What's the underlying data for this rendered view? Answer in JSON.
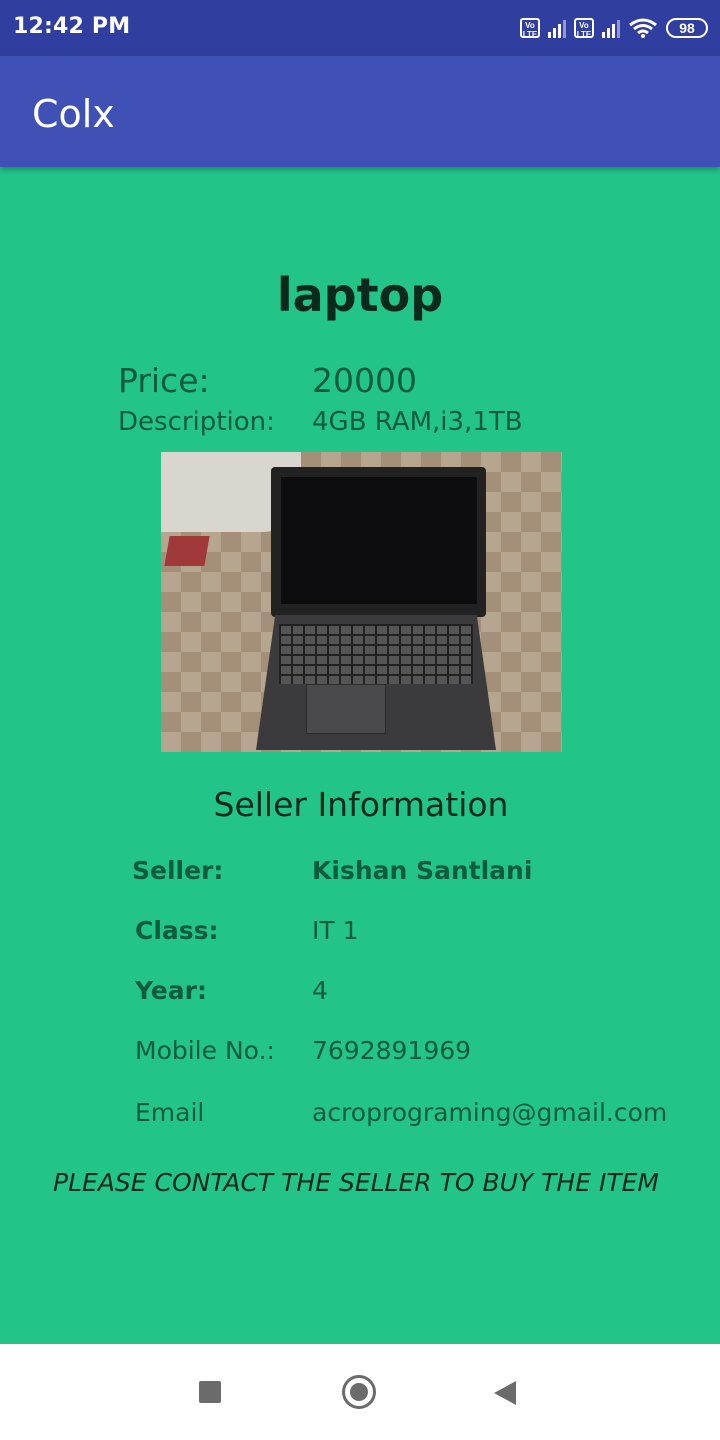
{
  "status": {
    "time": "12:42 PM",
    "volte1": "Vo LTE",
    "volte2": "Vo LTE",
    "battery": "98"
  },
  "app": {
    "title": "Colx"
  },
  "product": {
    "name": "laptop",
    "price_label": "Price:",
    "price_value": "20000",
    "description_label": "Description:",
    "description_value": "4GB RAM,i3,1TB"
  },
  "seller": {
    "heading": "Seller Information",
    "rows": [
      {
        "label": "Seller:",
        "value": "Kishan Santlani"
      },
      {
        "label": "Class:",
        "value": "IT 1"
      },
      {
        "label": "Year:",
        "value": "4"
      },
      {
        "label": "Mobile No.:",
        "value": "7692891969"
      },
      {
        "label": "Email",
        "value": "acroprograming@gmail.com"
      }
    ]
  },
  "notice": "PLEASE CONTACT THE SELLER TO BUY THE ITEM",
  "icons": {
    "nav": [
      "recent-apps-icon",
      "home-icon",
      "back-icon"
    ],
    "status": [
      "volte-icon",
      "signal-icon",
      "wifi-icon",
      "battery-icon"
    ]
  },
  "colors": {
    "status_bar": "#303f9f",
    "app_bar": "#3f51b5",
    "background": "#22c587",
    "text_dark": "#0b2a1d",
    "text_green": "#0f5c3d"
  }
}
